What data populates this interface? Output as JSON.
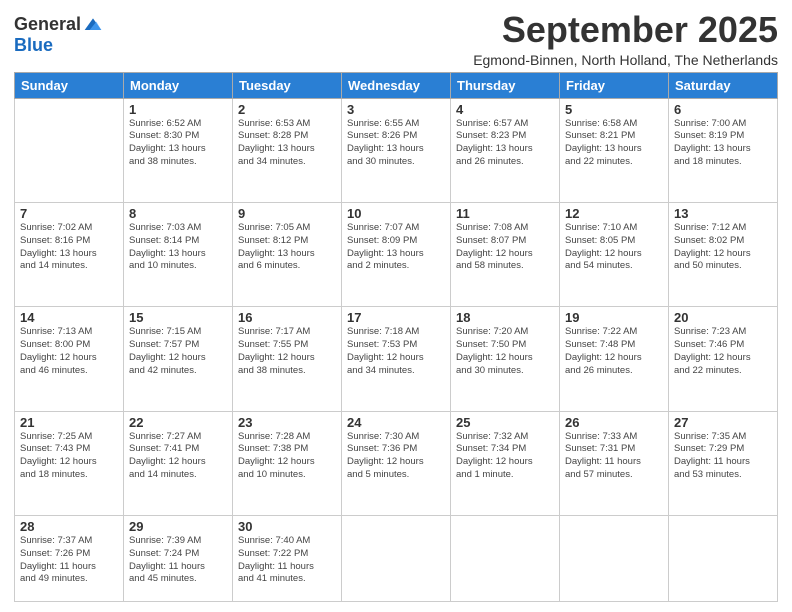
{
  "logo": {
    "general": "General",
    "blue": "Blue"
  },
  "header": {
    "month": "September 2025",
    "location": "Egmond-Binnen, North Holland, The Netherlands"
  },
  "weekdays": [
    "Sunday",
    "Monday",
    "Tuesday",
    "Wednesday",
    "Thursday",
    "Friday",
    "Saturday"
  ],
  "weeks": [
    [
      {
        "day": "",
        "info": ""
      },
      {
        "day": "1",
        "info": "Sunrise: 6:52 AM\nSunset: 8:30 PM\nDaylight: 13 hours\nand 38 minutes."
      },
      {
        "day": "2",
        "info": "Sunrise: 6:53 AM\nSunset: 8:28 PM\nDaylight: 13 hours\nand 34 minutes."
      },
      {
        "day": "3",
        "info": "Sunrise: 6:55 AM\nSunset: 8:26 PM\nDaylight: 13 hours\nand 30 minutes."
      },
      {
        "day": "4",
        "info": "Sunrise: 6:57 AM\nSunset: 8:23 PM\nDaylight: 13 hours\nand 26 minutes."
      },
      {
        "day": "5",
        "info": "Sunrise: 6:58 AM\nSunset: 8:21 PM\nDaylight: 13 hours\nand 22 minutes."
      },
      {
        "day": "6",
        "info": "Sunrise: 7:00 AM\nSunset: 8:19 PM\nDaylight: 13 hours\nand 18 minutes."
      }
    ],
    [
      {
        "day": "7",
        "info": "Sunrise: 7:02 AM\nSunset: 8:16 PM\nDaylight: 13 hours\nand 14 minutes."
      },
      {
        "day": "8",
        "info": "Sunrise: 7:03 AM\nSunset: 8:14 PM\nDaylight: 13 hours\nand 10 minutes."
      },
      {
        "day": "9",
        "info": "Sunrise: 7:05 AM\nSunset: 8:12 PM\nDaylight: 13 hours\nand 6 minutes."
      },
      {
        "day": "10",
        "info": "Sunrise: 7:07 AM\nSunset: 8:09 PM\nDaylight: 13 hours\nand 2 minutes."
      },
      {
        "day": "11",
        "info": "Sunrise: 7:08 AM\nSunset: 8:07 PM\nDaylight: 12 hours\nand 58 minutes."
      },
      {
        "day": "12",
        "info": "Sunrise: 7:10 AM\nSunset: 8:05 PM\nDaylight: 12 hours\nand 54 minutes."
      },
      {
        "day": "13",
        "info": "Sunrise: 7:12 AM\nSunset: 8:02 PM\nDaylight: 12 hours\nand 50 minutes."
      }
    ],
    [
      {
        "day": "14",
        "info": "Sunrise: 7:13 AM\nSunset: 8:00 PM\nDaylight: 12 hours\nand 46 minutes."
      },
      {
        "day": "15",
        "info": "Sunrise: 7:15 AM\nSunset: 7:57 PM\nDaylight: 12 hours\nand 42 minutes."
      },
      {
        "day": "16",
        "info": "Sunrise: 7:17 AM\nSunset: 7:55 PM\nDaylight: 12 hours\nand 38 minutes."
      },
      {
        "day": "17",
        "info": "Sunrise: 7:18 AM\nSunset: 7:53 PM\nDaylight: 12 hours\nand 34 minutes."
      },
      {
        "day": "18",
        "info": "Sunrise: 7:20 AM\nSunset: 7:50 PM\nDaylight: 12 hours\nand 30 minutes."
      },
      {
        "day": "19",
        "info": "Sunrise: 7:22 AM\nSunset: 7:48 PM\nDaylight: 12 hours\nand 26 minutes."
      },
      {
        "day": "20",
        "info": "Sunrise: 7:23 AM\nSunset: 7:46 PM\nDaylight: 12 hours\nand 22 minutes."
      }
    ],
    [
      {
        "day": "21",
        "info": "Sunrise: 7:25 AM\nSunset: 7:43 PM\nDaylight: 12 hours\nand 18 minutes."
      },
      {
        "day": "22",
        "info": "Sunrise: 7:27 AM\nSunset: 7:41 PM\nDaylight: 12 hours\nand 14 minutes."
      },
      {
        "day": "23",
        "info": "Sunrise: 7:28 AM\nSunset: 7:38 PM\nDaylight: 12 hours\nand 10 minutes."
      },
      {
        "day": "24",
        "info": "Sunrise: 7:30 AM\nSunset: 7:36 PM\nDaylight: 12 hours\nand 5 minutes."
      },
      {
        "day": "25",
        "info": "Sunrise: 7:32 AM\nSunset: 7:34 PM\nDaylight: 12 hours\nand 1 minute."
      },
      {
        "day": "26",
        "info": "Sunrise: 7:33 AM\nSunset: 7:31 PM\nDaylight: 11 hours\nand 57 minutes."
      },
      {
        "day": "27",
        "info": "Sunrise: 7:35 AM\nSunset: 7:29 PM\nDaylight: 11 hours\nand 53 minutes."
      }
    ],
    [
      {
        "day": "28",
        "info": "Sunrise: 7:37 AM\nSunset: 7:26 PM\nDaylight: 11 hours\nand 49 minutes."
      },
      {
        "day": "29",
        "info": "Sunrise: 7:39 AM\nSunset: 7:24 PM\nDaylight: 11 hours\nand 45 minutes."
      },
      {
        "day": "30",
        "info": "Sunrise: 7:40 AM\nSunset: 7:22 PM\nDaylight: 11 hours\nand 41 minutes."
      },
      {
        "day": "",
        "info": ""
      },
      {
        "day": "",
        "info": ""
      },
      {
        "day": "",
        "info": ""
      },
      {
        "day": "",
        "info": ""
      }
    ]
  ]
}
